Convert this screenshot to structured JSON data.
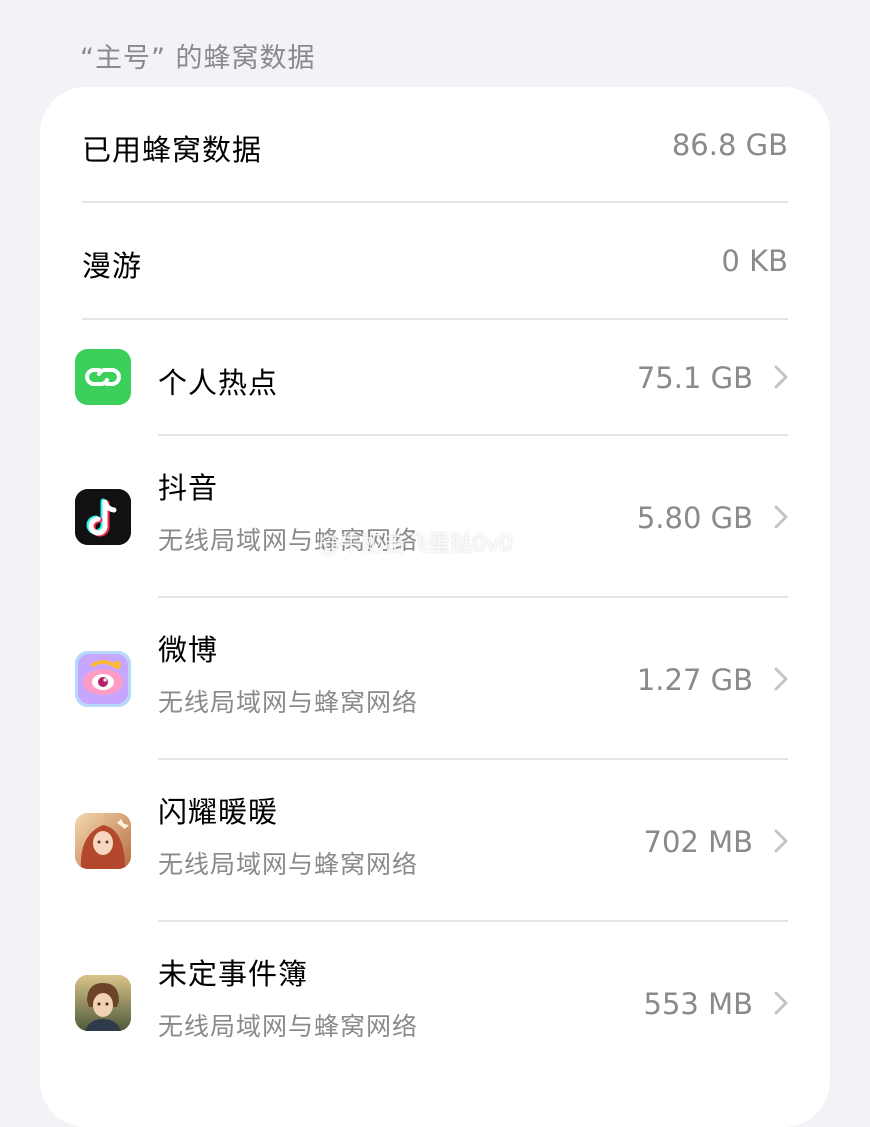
{
  "section_header": "“主号” 的蜂窝数据",
  "summary": {
    "used_label": "已用蜂窝数据",
    "used_value": "86.8 GB",
    "roaming_label": "漫游",
    "roaming_value": "0 KB"
  },
  "apps": [
    {
      "name": "个人热点",
      "subtitle": "",
      "usage": "75.1 GB",
      "icon": "personal-hotspot-icon",
      "icon_color": "#34c759"
    },
    {
      "name": "抖音",
      "subtitle": "无线局域网与蜂窝网络",
      "usage": "5.80 GB",
      "icon": "douyin-icon",
      "icon_color": "#111111"
    },
    {
      "name": "微博",
      "subtitle": "无线局域网与蜂窝网络",
      "usage": "1.27 GB",
      "icon": "weibo-icon",
      "icon_color": "#9ec9f7"
    },
    {
      "name": "闪耀暖暖",
      "subtitle": "无线局域网与蜂窝网络",
      "usage": "702 MB",
      "icon": "shining-nikki-icon",
      "icon_color": "#c98a5c"
    },
    {
      "name": "未定事件簿",
      "subtitle": "无线局域网与蜂窝网络",
      "usage": "553 MB",
      "icon": "tears-of-themis-icon",
      "icon_color": "#7a5a3a"
    }
  ],
  "watermark": "@牛奶击飞蛋挞0v0"
}
